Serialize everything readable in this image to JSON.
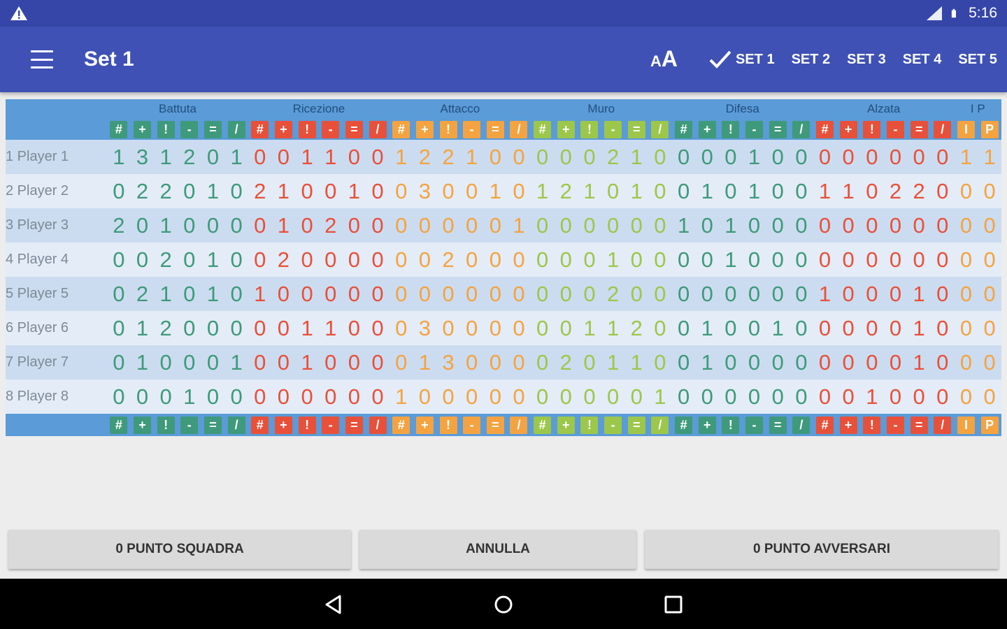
{
  "status_bar": {
    "time": "5:16"
  },
  "app_bar": {
    "title": "Set 1",
    "font_size_small": "A",
    "font_size_big": "A",
    "sets": [
      "SET 1",
      "SET 2",
      "SET 3",
      "SET 4",
      "SET 5"
    ],
    "active_set": 0
  },
  "categories": [
    {
      "label": "Battuta",
      "span": 6
    },
    {
      "label": "Ricezione",
      "span": 6
    },
    {
      "label": "Attacco",
      "span": 6
    },
    {
      "label": "Muro",
      "span": 6
    },
    {
      "label": "Difesa",
      "span": 6
    },
    {
      "label": "Alzata",
      "span": 6
    },
    {
      "label": "I P",
      "span": 2
    }
  ],
  "columns": [
    {
      "sym": "#",
      "color": "#3e9a7a"
    },
    {
      "sym": "+",
      "color": "#3e9a7a"
    },
    {
      "sym": "!",
      "color": "#3e9a7a"
    },
    {
      "sym": "-",
      "color": "#3e9a7a"
    },
    {
      "sym": "=",
      "color": "#3e9a7a"
    },
    {
      "sym": "/",
      "color": "#3e9a7a"
    },
    {
      "sym": "#",
      "color": "#e8503a"
    },
    {
      "sym": "+",
      "color": "#e8503a"
    },
    {
      "sym": "!",
      "color": "#e8503a"
    },
    {
      "sym": "-",
      "color": "#e8503a"
    },
    {
      "sym": "=",
      "color": "#e8503a"
    },
    {
      "sym": "/",
      "color": "#e8503a"
    },
    {
      "sym": "#",
      "color": "#f4a340"
    },
    {
      "sym": "+",
      "color": "#f4a340"
    },
    {
      "sym": "!",
      "color": "#f4a340"
    },
    {
      "sym": "-",
      "color": "#f4a340"
    },
    {
      "sym": "=",
      "color": "#f4a340"
    },
    {
      "sym": "/",
      "color": "#f4a340"
    },
    {
      "sym": "#",
      "color": "#9cc74a"
    },
    {
      "sym": "+",
      "color": "#9cc74a"
    },
    {
      "sym": "!",
      "color": "#9cc74a"
    },
    {
      "sym": "-",
      "color": "#9cc74a"
    },
    {
      "sym": "=",
      "color": "#9cc74a"
    },
    {
      "sym": "/",
      "color": "#9cc74a"
    },
    {
      "sym": "#",
      "color": "#3e9a7a"
    },
    {
      "sym": "+",
      "color": "#3e9a7a"
    },
    {
      "sym": "!",
      "color": "#3e9a7a"
    },
    {
      "sym": "-",
      "color": "#3e9a7a"
    },
    {
      "sym": "=",
      "color": "#3e9a7a"
    },
    {
      "sym": "/",
      "color": "#3e9a7a"
    },
    {
      "sym": "#",
      "color": "#e8503a"
    },
    {
      "sym": "+",
      "color": "#e8503a"
    },
    {
      "sym": "!",
      "color": "#e8503a"
    },
    {
      "sym": "-",
      "color": "#e8503a"
    },
    {
      "sym": "=",
      "color": "#e8503a"
    },
    {
      "sym": "/",
      "color": "#e8503a"
    },
    {
      "sym": "I",
      "color": "#f4a340"
    },
    {
      "sym": "P",
      "color": "#f4a340"
    }
  ],
  "players": [
    {
      "name": "1 Player 1",
      "values": [
        1,
        3,
        1,
        2,
        0,
        1,
        0,
        0,
        1,
        1,
        0,
        0,
        1,
        2,
        2,
        1,
        0,
        0,
        0,
        0,
        0,
        2,
        1,
        0,
        0,
        0,
        0,
        1,
        0,
        0,
        0,
        0,
        0,
        0,
        0,
        0,
        1,
        1
      ]
    },
    {
      "name": "2 Player 2",
      "values": [
        0,
        2,
        2,
        0,
        1,
        0,
        2,
        1,
        0,
        0,
        1,
        0,
        0,
        3,
        0,
        0,
        1,
        0,
        1,
        2,
        1,
        0,
        1,
        0,
        0,
        1,
        0,
        1,
        0,
        0,
        1,
        1,
        0,
        2,
        2,
        0,
        0,
        0
      ]
    },
    {
      "name": "3 Player 3",
      "values": [
        2,
        0,
        1,
        0,
        0,
        0,
        0,
        1,
        0,
        2,
        0,
        0,
        0,
        0,
        0,
        0,
        0,
        1,
        0,
        0,
        0,
        0,
        0,
        0,
        1,
        0,
        1,
        0,
        0,
        0,
        0,
        0,
        0,
        0,
        0,
        0,
        0,
        0
      ]
    },
    {
      "name": "4 Player 4",
      "values": [
        0,
        0,
        2,
        0,
        1,
        0,
        0,
        2,
        0,
        0,
        0,
        0,
        0,
        0,
        2,
        0,
        0,
        0,
        0,
        0,
        0,
        1,
        0,
        0,
        0,
        0,
        1,
        0,
        0,
        0,
        0,
        0,
        0,
        0,
        0,
        0,
        0,
        0
      ]
    },
    {
      "name": "5 Player 5",
      "values": [
        0,
        2,
        1,
        0,
        1,
        0,
        1,
        0,
        0,
        0,
        0,
        0,
        0,
        0,
        0,
        0,
        0,
        0,
        0,
        0,
        0,
        2,
        0,
        0,
        0,
        0,
        0,
        0,
        0,
        0,
        1,
        0,
        0,
        0,
        1,
        0,
        0,
        0
      ]
    },
    {
      "name": "6 Player 6",
      "values": [
        0,
        1,
        2,
        0,
        0,
        0,
        0,
        0,
        1,
        1,
        0,
        0,
        0,
        3,
        0,
        0,
        0,
        0,
        0,
        0,
        1,
        1,
        2,
        0,
        0,
        1,
        0,
        0,
        1,
        0,
        0,
        0,
        0,
        0,
        1,
        0,
        0,
        0
      ]
    },
    {
      "name": "7 Player 7",
      "values": [
        0,
        1,
        0,
        0,
        0,
        1,
        0,
        0,
        1,
        0,
        0,
        0,
        0,
        1,
        3,
        0,
        0,
        0,
        0,
        2,
        0,
        1,
        1,
        0,
        0,
        1,
        0,
        0,
        0,
        0,
        0,
        0,
        0,
        0,
        1,
        0,
        0,
        0
      ]
    },
    {
      "name": "8 Player 8",
      "values": [
        0,
        0,
        0,
        1,
        0,
        0,
        0,
        0,
        0,
        0,
        0,
        0,
        1,
        0,
        0,
        0,
        0,
        0,
        0,
        0,
        0,
        0,
        0,
        1,
        0,
        0,
        0,
        0,
        0,
        0,
        0,
        0,
        1,
        0,
        0,
        0,
        0,
        0
      ]
    }
  ],
  "actions": {
    "team_point": "0 PUNTO SQUADRA",
    "undo": "ANNULLA",
    "opponent_point": "0 PUNTO AVVERSARI"
  },
  "icons": [
    "warning-icon",
    "signal-icon",
    "battery-icon",
    "menu-icon",
    "font-size-icon",
    "check-icon",
    "back-icon",
    "home-icon",
    "recents-icon"
  ]
}
